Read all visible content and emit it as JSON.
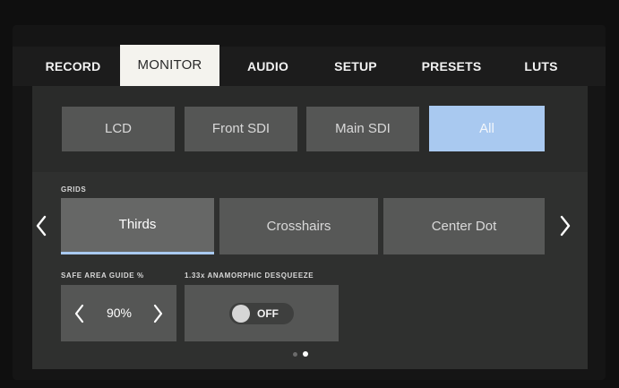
{
  "tabs": [
    {
      "label": "RECORD",
      "active": false
    },
    {
      "label": "MONITOR",
      "active": true
    },
    {
      "label": "AUDIO",
      "active": false
    },
    {
      "label": "SETUP",
      "active": false
    },
    {
      "label": "PRESETS",
      "active": false
    },
    {
      "label": "LUTS",
      "active": false
    }
  ],
  "outputs": [
    {
      "label": "LCD",
      "selected": false
    },
    {
      "label": "Front SDI",
      "selected": false
    },
    {
      "label": "Main SDI",
      "selected": false
    },
    {
      "label": "All",
      "selected": true
    }
  ],
  "grids": {
    "label": "GRIDS",
    "options": [
      {
        "label": "Thirds",
        "selected": true
      },
      {
        "label": "Crosshairs",
        "selected": false
      },
      {
        "label": "Center Dot",
        "selected": false
      }
    ]
  },
  "safe_area": {
    "label": "SAFE AREA GUIDE %",
    "value": "90%"
  },
  "desqueeze": {
    "label": "1.33x ANAMORPHIC DESQUEEZE",
    "state": "OFF"
  },
  "pagination": {
    "pages": 2,
    "current": 2
  },
  "colors": {
    "accent": "#a9c9f0",
    "button": "#555655",
    "panel": "#2a2b2a"
  }
}
